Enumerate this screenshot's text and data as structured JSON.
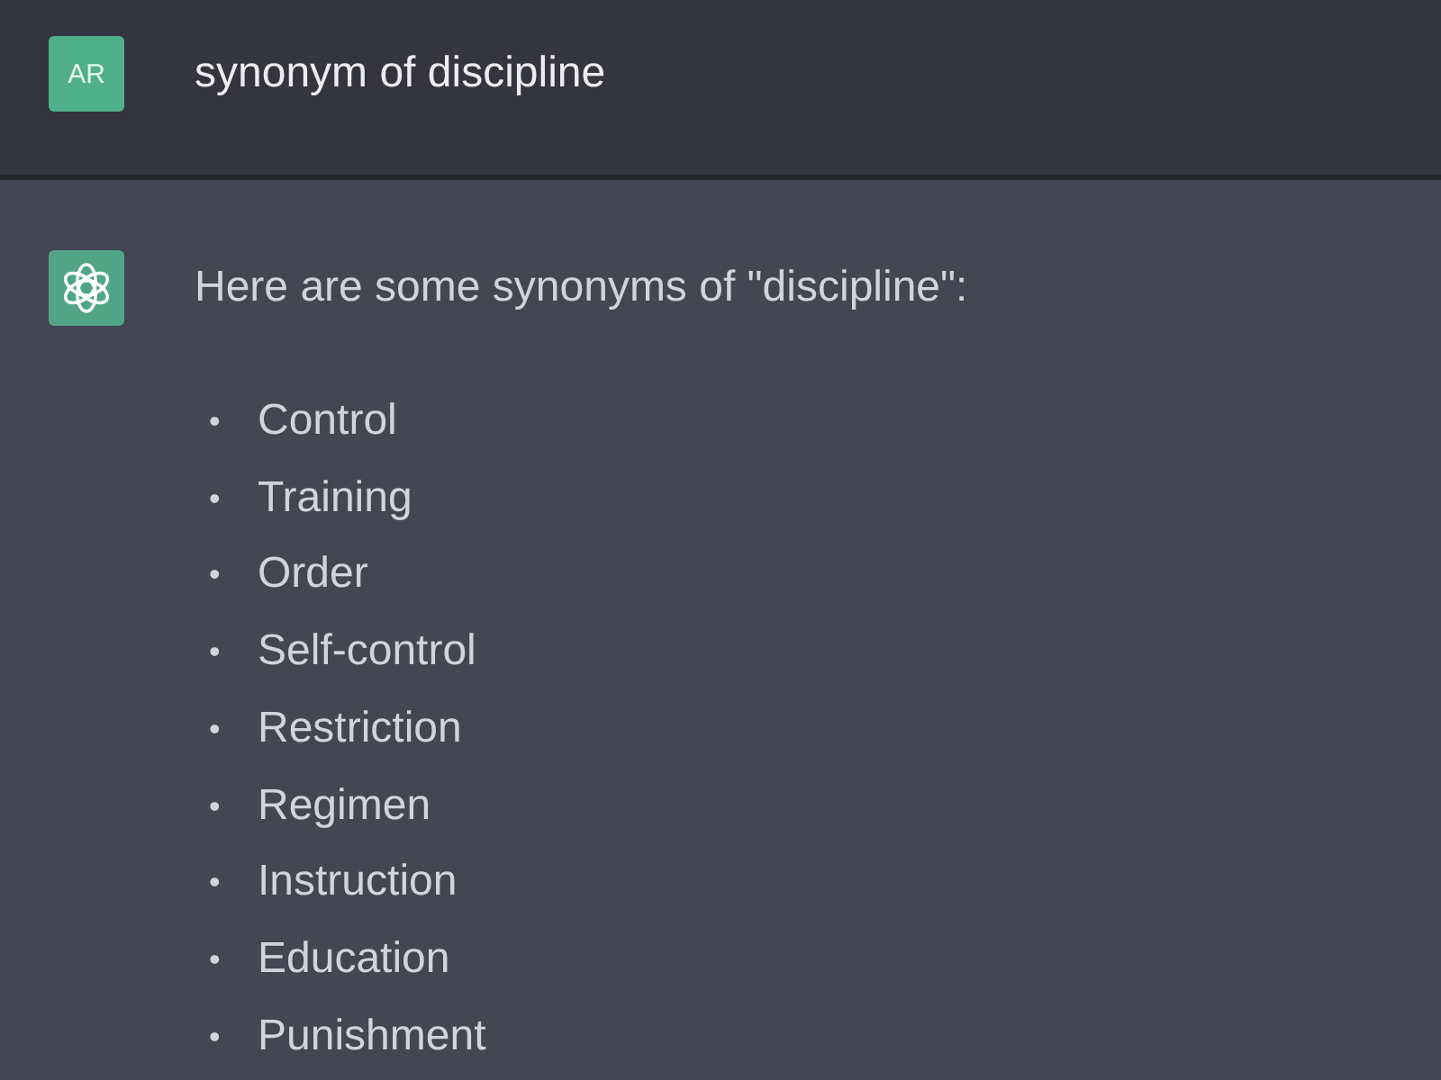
{
  "user_message": {
    "avatar": "AR",
    "text": "synonym of discipline"
  },
  "assistant_message": {
    "intro": "Here are some synonyms of \"discipline\":",
    "items": [
      {
        "marker": "•",
        "text": "Control"
      },
      {
        "marker": "•",
        "text": "Training"
      },
      {
        "marker": "•",
        "text": "Order"
      },
      {
        "marker": "•",
        "text": "Self-control"
      },
      {
        "marker": "•",
        "text": "Restriction"
      },
      {
        "marker": "•",
        "text": "Regimen"
      },
      {
        "marker": "•",
        "text": "Instruction"
      },
      {
        "marker": "•",
        "text": "Education"
      },
      {
        "marker": "•",
        "text": "Punishment"
      }
    ]
  }
}
